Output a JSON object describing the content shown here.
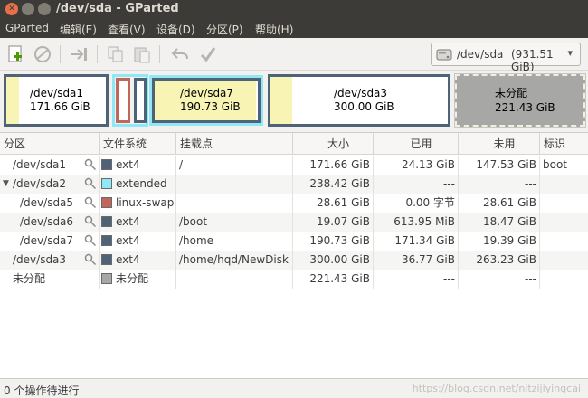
{
  "window": {
    "title": "/dev/sda - GParted"
  },
  "menu": [
    "GParted",
    "编辑(E)",
    "查看(V)",
    "设备(D)",
    "分区(P)",
    "帮助(H)"
  ],
  "toolbar": {
    "icons": [
      "new-partition-icon",
      "delete-icon",
      "resize-move-icon",
      "copy-icon",
      "paste-icon",
      "undo-icon",
      "apply-icon"
    ]
  },
  "device": {
    "name": "/dev/sda",
    "size": "(931.51 GiB)"
  },
  "map": [
    {
      "name": "/dev/sda1",
      "size": "171.66 GiB"
    },
    {
      "name": "/dev/sda7",
      "size": "190.73 GiB"
    },
    {
      "name": "/dev/sda3",
      "size": "300.00 GiB"
    },
    {
      "name": "未分配",
      "size": "221.43 GiB"
    }
  ],
  "table": {
    "columns": [
      "分区",
      "文件系统",
      "挂载点",
      "大小",
      "已用",
      "未用",
      "标识"
    ],
    "rows": [
      {
        "partition": "/dev/sda1",
        "fs": "ext4",
        "fs_color": "#4f6378",
        "mount": "/",
        "size": "171.66 GiB",
        "used": "24.13 GiB",
        "unused": "147.53 GiB",
        "flags": "boot"
      },
      {
        "partition": "/dev/sda2",
        "fs": "extended",
        "fs_color": "#8fe8f5",
        "mount": "",
        "size": "238.42 GiB",
        "used": "---",
        "unused": "---",
        "flags": ""
      },
      {
        "partition": "/dev/sda5",
        "fs": "linux-swap",
        "fs_color": "#c1665a",
        "mount": "",
        "size": "28.61 GiB",
        "used": "0.00 字节",
        "unused": "28.61 GiB",
        "flags": ""
      },
      {
        "partition": "/dev/sda6",
        "fs": "ext4",
        "fs_color": "#4f6378",
        "mount": "/boot",
        "size": "19.07 GiB",
        "used": "613.95 MiB",
        "unused": "18.47 GiB",
        "flags": ""
      },
      {
        "partition": "/dev/sda7",
        "fs": "ext4",
        "fs_color": "#4f6378",
        "mount": "/home",
        "size": "190.73 GiB",
        "used": "171.34 GiB",
        "unused": "19.39 GiB",
        "flags": ""
      },
      {
        "partition": "/dev/sda3",
        "fs": "ext4",
        "fs_color": "#4f6378",
        "mount": "/home/hqd/NewDisk",
        "size": "300.00 GiB",
        "used": "36.77 GiB",
        "unused": "263.23 GiB",
        "flags": ""
      },
      {
        "partition": "未分配",
        "fs": "未分配",
        "fs_color": "#a7a7a5",
        "mount": "",
        "size": "221.43 GiB",
        "used": "---",
        "unused": "---",
        "flags": ""
      }
    ]
  },
  "status": {
    "text": "0 个操作待进行",
    "watermark": "https://blog.csdn.net/nitzijiyingcai"
  }
}
